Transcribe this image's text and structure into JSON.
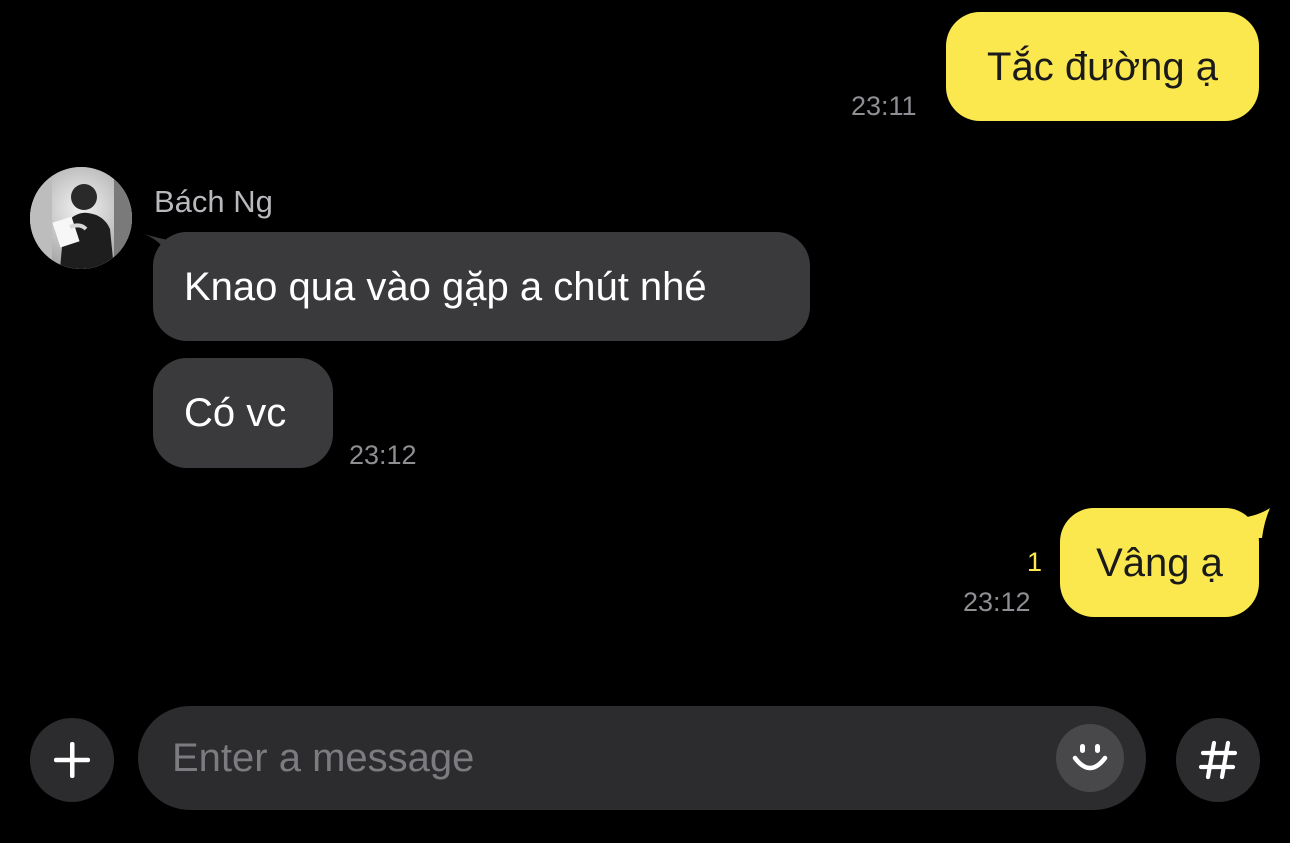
{
  "conversation": {
    "messages": [
      {
        "direction": "outgoing",
        "text": "Tắc đường ạ",
        "time": "23:11"
      },
      {
        "direction": "incoming",
        "sender": "Bách Ng",
        "text": "Knao qua vào gặp a chút nhé"
      },
      {
        "direction": "incoming",
        "text": "Có vc",
        "time": "23:12"
      },
      {
        "direction": "outgoing",
        "text": "Vâng ạ",
        "time": "23:12",
        "unread_count": "1"
      }
    ]
  },
  "composer": {
    "placeholder": "Enter a message",
    "value": "",
    "add_icon": "plus-icon",
    "emoji_icon": "smiley-icon",
    "hashtag_icon": "hash-icon"
  },
  "colors": {
    "outgoing_bubble": "#FAE84E",
    "incoming_bubble": "#3A3A3C",
    "background": "#000000",
    "unread_indicator": "#FAE84E"
  }
}
